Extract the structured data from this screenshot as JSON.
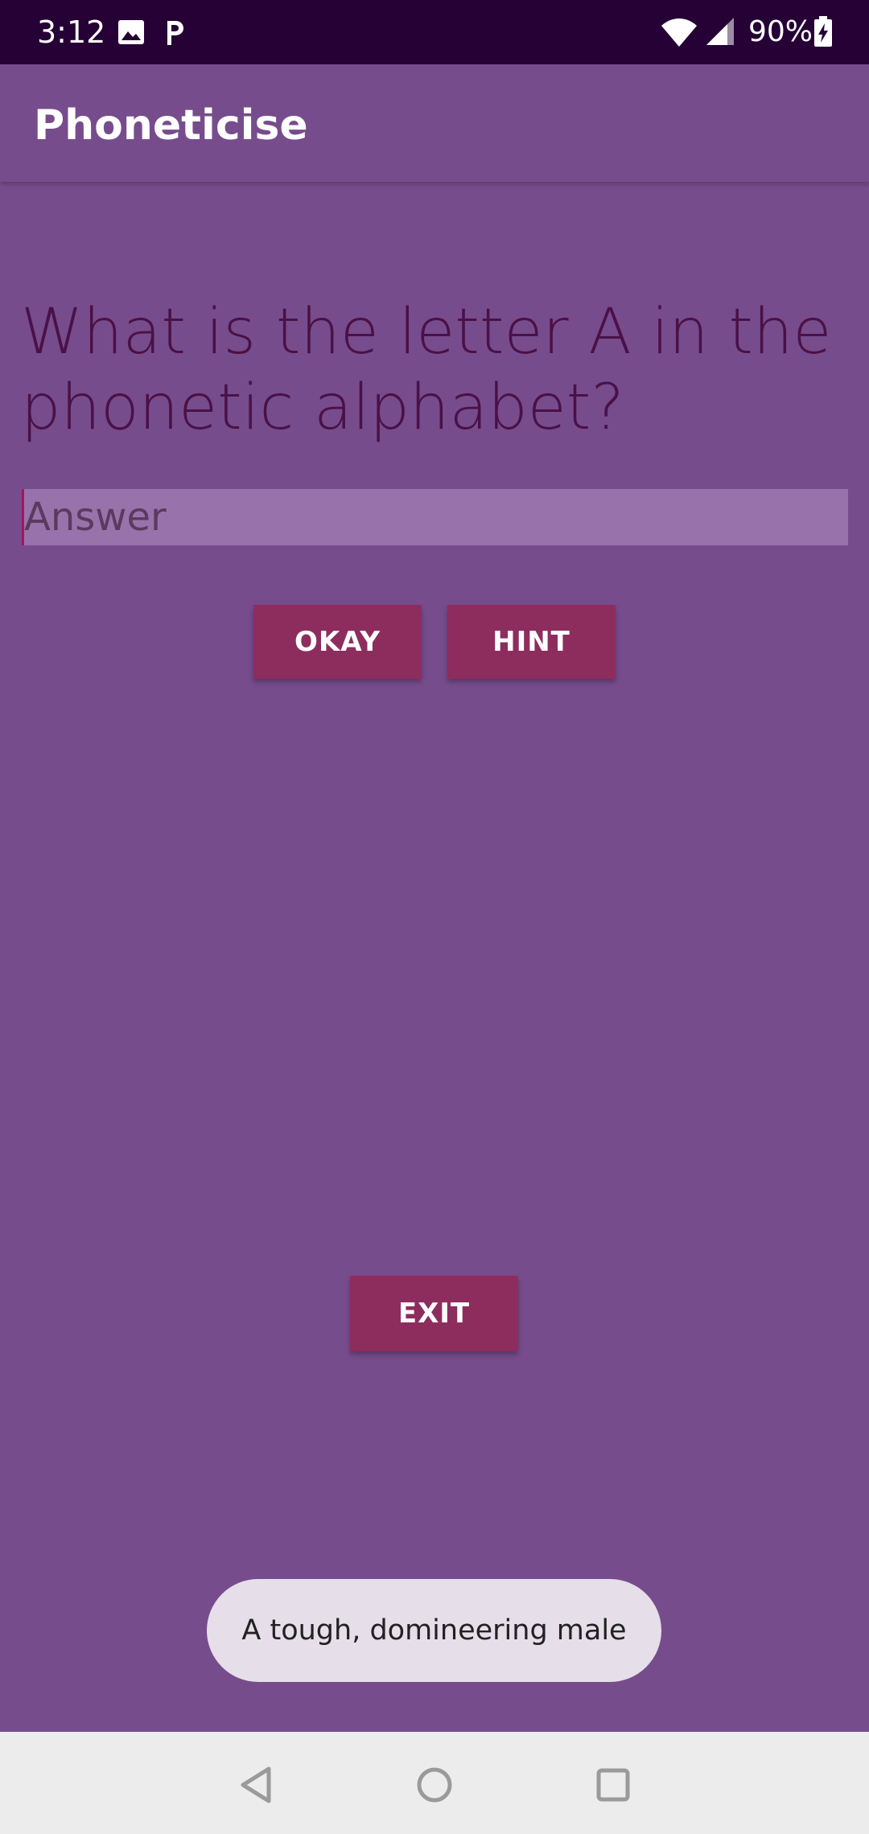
{
  "status_bar": {
    "time": "3:12",
    "battery": "90%",
    "icons": [
      "image-icon",
      "parking-icon",
      "wifi-icon",
      "signal-icon",
      "battery-charging-icon"
    ]
  },
  "app_bar": {
    "title": "Phoneticise"
  },
  "quiz": {
    "question": "What is the letter A in the phonetic alphabet?",
    "answer_placeholder": "Answer",
    "answer_value": ""
  },
  "buttons": {
    "okay": "OKAY",
    "hint": "HINT",
    "exit": "EXIT"
  },
  "toast": {
    "message": "A tough, domineering male"
  },
  "nav_bar": {
    "icons": [
      "back-icon",
      "home-icon",
      "recents-icon"
    ]
  },
  "colors": {
    "background": "#774c8c",
    "status_bar": "#250136",
    "button": "#8d2d5e",
    "question_text": "#4a1147",
    "toast_bg": "#e6dee9"
  }
}
